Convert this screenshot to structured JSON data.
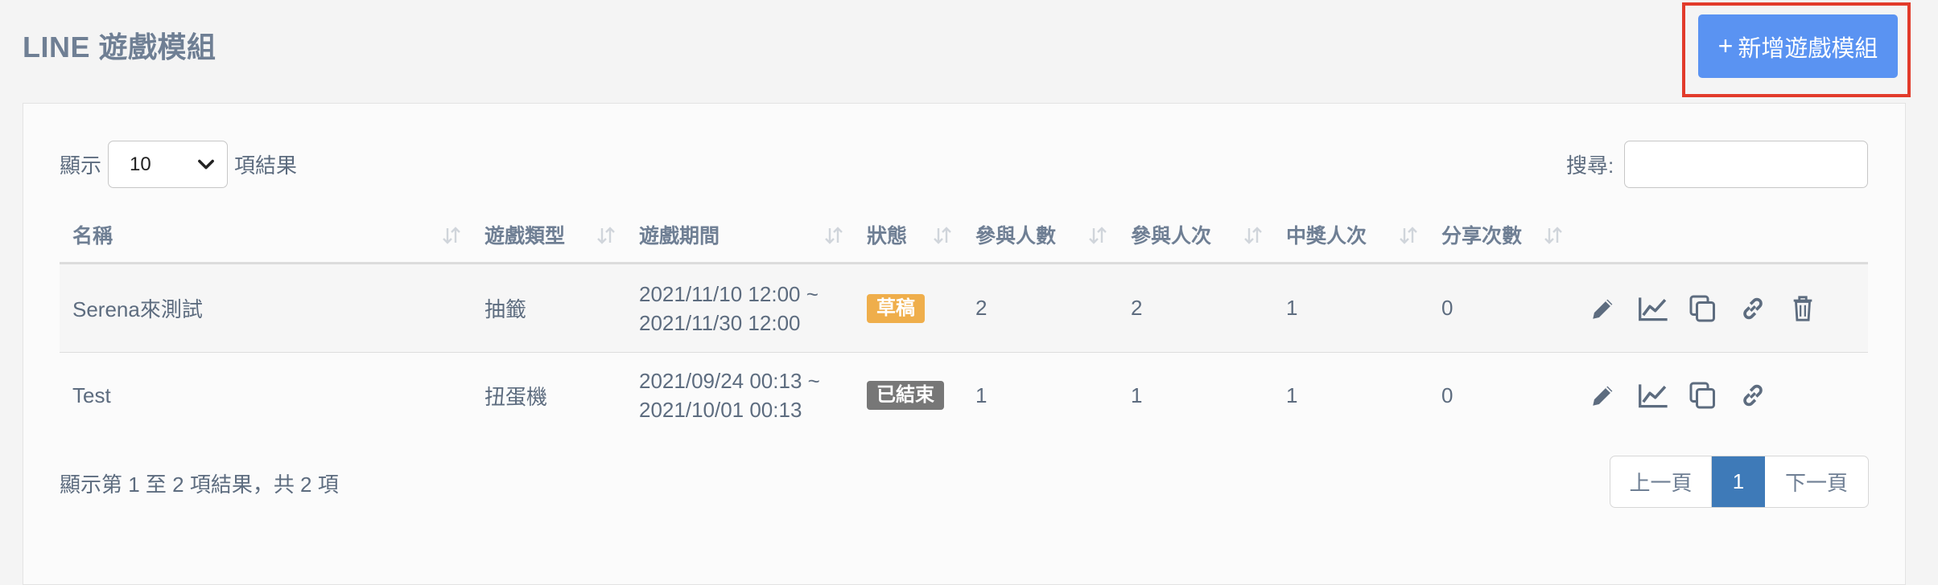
{
  "header": {
    "title": "LINE 遊戲模組",
    "add_plus": "+",
    "add_button": "新增遊戲模組"
  },
  "controls": {
    "length_prefix": "顯示",
    "length_value": "10",
    "length_suffix": "項結果",
    "search_label": "搜尋:"
  },
  "table": {
    "columns": [
      "名稱",
      "遊戲類型",
      "遊戲期間",
      "狀態",
      "參與人數",
      "參與人次",
      "中獎人次",
      "分享次數"
    ],
    "rows": [
      {
        "name": "Serena來測試",
        "type": "抽籤",
        "period_start": "2021/11/10 12:00 ~",
        "period_end": "2021/11/30 12:00",
        "status": "草稿",
        "participants": "2",
        "participations": "2",
        "winners": "1",
        "shares": "0",
        "actions": [
          "pencil-icon",
          "chart-icon",
          "copy-icon",
          "link-icon",
          "trash-icon"
        ]
      },
      {
        "name": "Test",
        "type": "扭蛋機",
        "period_start": "2021/09/24 00:13 ~",
        "period_end": "2021/10/01 00:13",
        "status": "已結束",
        "participants": "1",
        "participations": "1",
        "winners": "1",
        "shares": "0",
        "actions": [
          "pencil-icon",
          "chart-icon",
          "copy-icon",
          "link-icon"
        ]
      }
    ]
  },
  "footer": {
    "info": "顯示第 1 至 2 項結果，共 2 項",
    "prev": "上一頁",
    "current": "1",
    "next": "下一頁"
  },
  "colors": {
    "accent": "#5a93f2",
    "highlight_border": "#e23b2b",
    "draft_badge": "#efae4b",
    "ended_badge": "#777777",
    "active_page": "#3e7ab8"
  }
}
